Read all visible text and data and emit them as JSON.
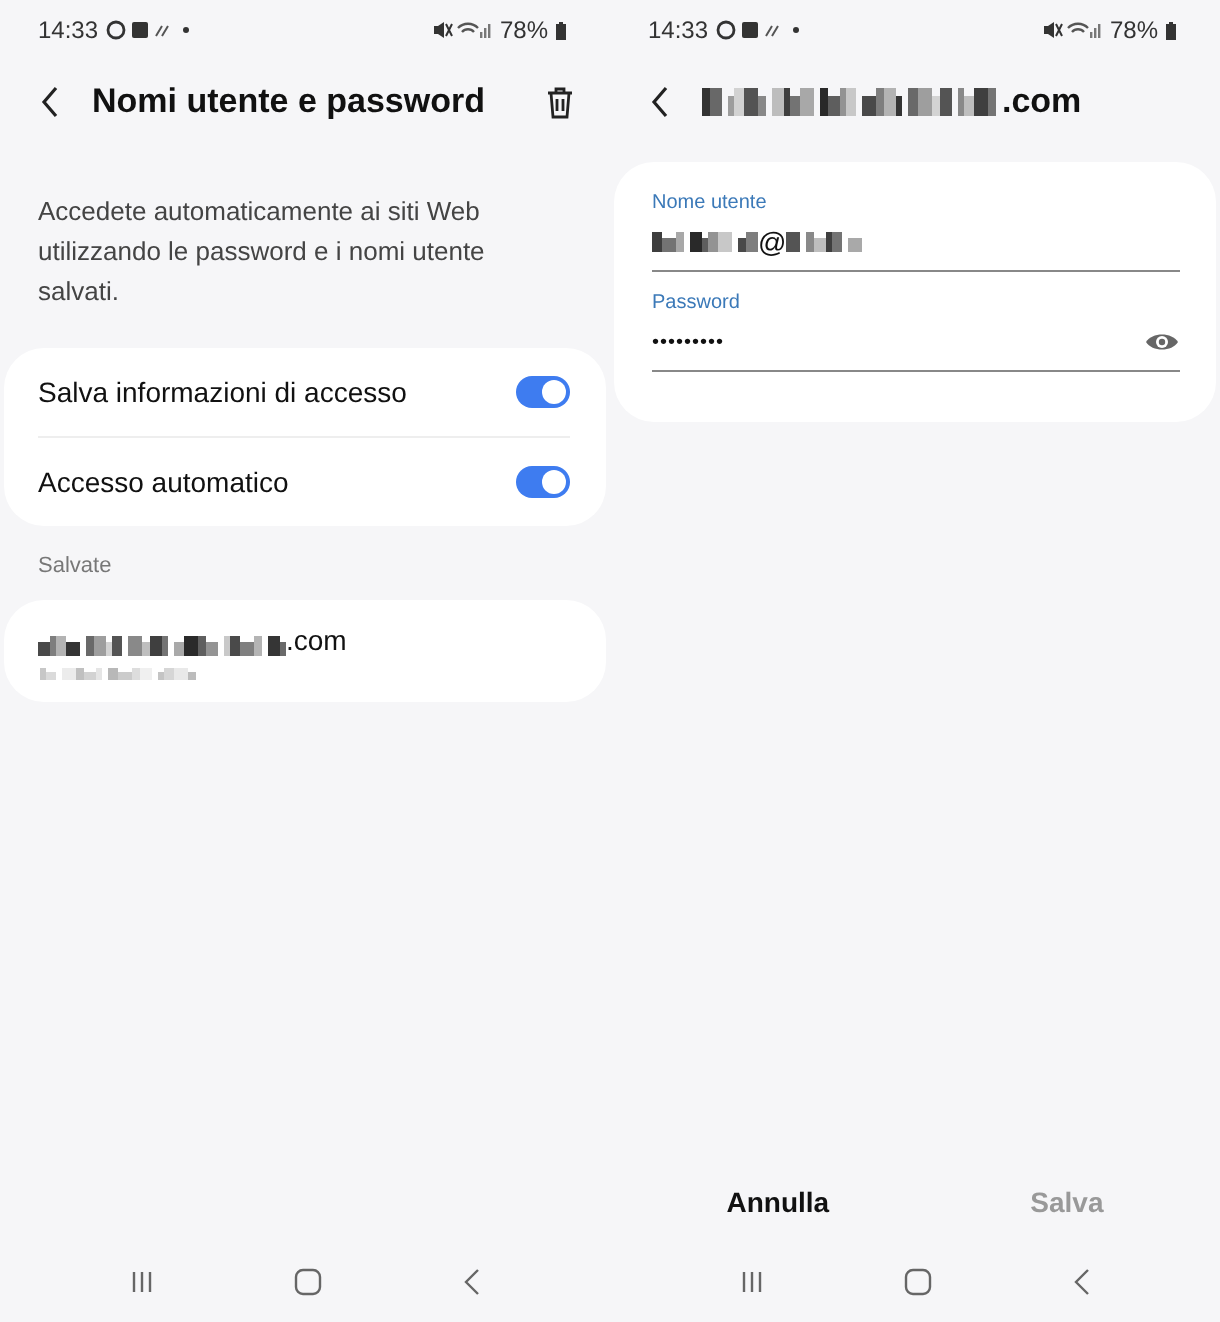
{
  "screens": [
    {
      "status_bar": {
        "time": "14:33",
        "battery": "78%"
      },
      "header": {
        "title": "Nomi utente e password"
      },
      "description": "Accedete automaticamente ai siti Web utilizzando le password e i nomi utente salvati.",
      "settings": [
        {
          "label": "Salva informazioni di accesso",
          "on": true
        },
        {
          "label": "Accesso automatico",
          "on": true
        }
      ],
      "section_label": "Salvate",
      "saved": [
        {
          "site": ".com"
        }
      ]
    },
    {
      "status_bar": {
        "time": "14:33",
        "battery": "78%"
      },
      "header": {
        "title_suffix": ".com"
      },
      "form": {
        "username_label": "Nome utente",
        "username_at": "@",
        "password_label": "Password",
        "password_value": "•••••••••"
      },
      "buttons": [
        {
          "label": "Annulla",
          "disabled": false
        },
        {
          "label": "Salva",
          "disabled": true
        }
      ]
    }
  ]
}
